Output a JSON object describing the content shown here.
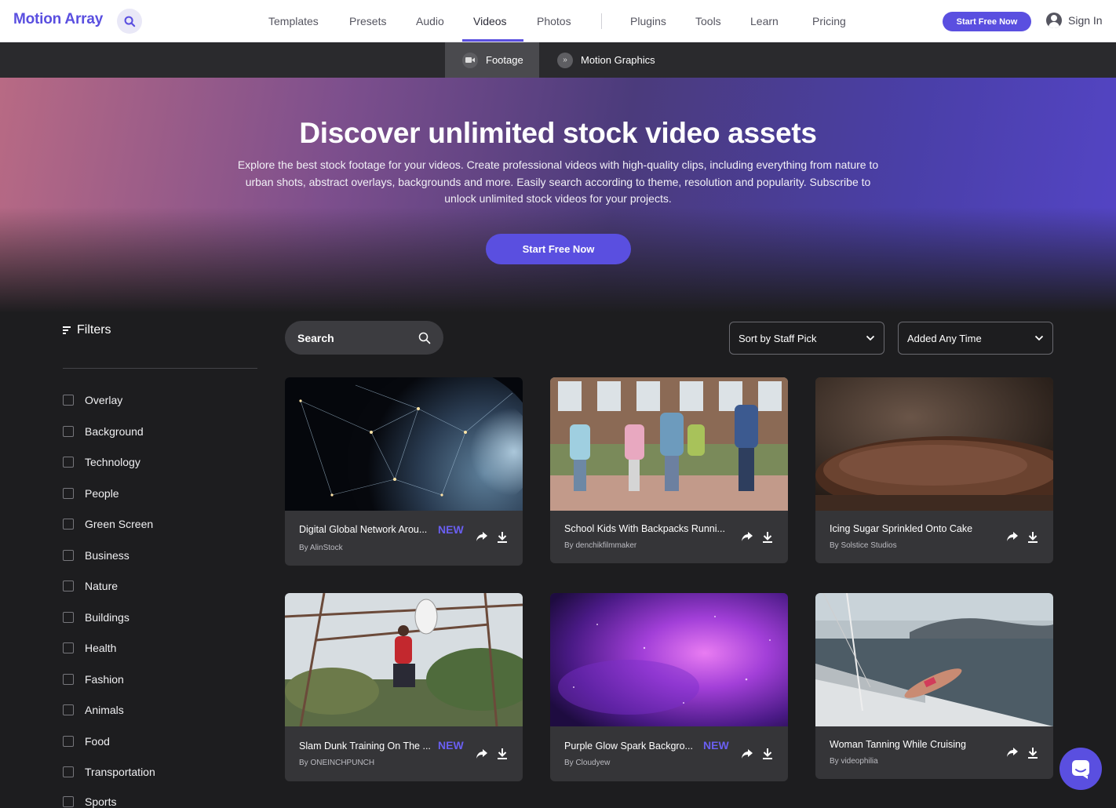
{
  "header": {
    "logo": "Motion Array",
    "nav": [
      "Templates",
      "Presets",
      "Audio",
      "Videos",
      "Photos",
      "Plugins",
      "Tools",
      "Learn",
      "Pricing"
    ],
    "active_nav": "Videos",
    "cta": "Start Free Now",
    "signin": "Sign In"
  },
  "subnav": {
    "tabs": [
      "Footage",
      "Motion Graphics"
    ],
    "active": "Footage"
  },
  "hero": {
    "title": "Discover unlimited stock video assets",
    "description": "Explore the best stock footage for your videos. Create professional videos with high-quality clips, including everything from nature to urban shots, abstract overlays, backgrounds and more. Easily search according to theme, resolution and popularity. Subscribe to unlock unlimited stock videos for your projects.",
    "cta": "Start Free Now"
  },
  "filters": {
    "heading": "Filters",
    "items": [
      "Overlay",
      "Background",
      "Technology",
      "People",
      "Green Screen",
      "Business",
      "Nature",
      "Buildings",
      "Health",
      "Fashion",
      "Animals",
      "Food",
      "Transportation",
      "Sports"
    ]
  },
  "toolbar": {
    "search_label": "Search",
    "sort": "Sort by Staff Pick",
    "time": "Added Any Time"
  },
  "cards": [
    {
      "title": "Digital Global Network Arou...",
      "author": "By AlinStock",
      "badge": "NEW"
    },
    {
      "title": "School Kids With Backpacks Runni...",
      "author": "By denchikfilmmaker",
      "badge": ""
    },
    {
      "title": "Icing Sugar Sprinkled Onto Cake",
      "author": "By Solstice Studios",
      "badge": ""
    },
    {
      "title": "Slam Dunk Training On The ...",
      "author": "By ONEINCHPUNCH",
      "badge": "NEW"
    },
    {
      "title": "Purple Glow Spark Backgro...",
      "author": "By Cloudyew",
      "badge": "NEW"
    },
    {
      "title": "Woman Tanning While Cruising",
      "author": "By videophilia",
      "badge": ""
    }
  ],
  "colors": {
    "accent": "#5a4fe0",
    "background": "#1d1d1f",
    "card": "#353538"
  }
}
